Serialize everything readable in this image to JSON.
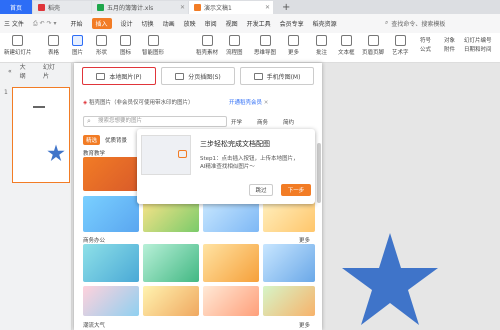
{
  "tabs": {
    "home": "首页",
    "t1": "稻壳",
    "t2": "五月的簿簿计.xls",
    "t3": "演示文稿1",
    "plus": "+"
  },
  "menu": {
    "file": "三 文件",
    "items": [
      "开始",
      "插入",
      "设计",
      "切换",
      "动画",
      "放映",
      "审阅",
      "视图",
      "开发工具",
      "会员专享",
      "稻壳资源"
    ],
    "active_index": 1,
    "search": "查找命令、搜索模板"
  },
  "ribbon": {
    "new_slide": "新建幻灯片",
    "table": "表格",
    "picture": "图片",
    "shape": "形状",
    "icon": "图标",
    "smart_graphic": "智能图形",
    "docer_material": "稻壳素材",
    "flowchart": "流程图",
    "mind_map": "思维导图",
    "more": "更多",
    "comment": "批注",
    "textbox": "文本框",
    "header_footer": "页眉页脚",
    "art_text": "艺术字",
    "symbol": "符号",
    "formula": "公式",
    "object": "对象",
    "slide_number": "幻灯片编号",
    "attachment": "附件",
    "date_time": "日期和时间"
  },
  "leftpanel": {
    "tab_outline": "大纲",
    "tab_slides": "幻灯片",
    "slide_num": "1"
  },
  "popup": {
    "tabs": [
      "本地图片(P)",
      "分页插图(S)",
      "手机传图(M)"
    ],
    "notice": "稻壳图片（非会员仅可使用带水印的图片）",
    "notice_link": "开通稻壳会员",
    "search_placeholder": "搜索您想要的图片",
    "buttons": [
      "开学",
      "商务",
      "简约"
    ],
    "categories": [
      "精选",
      "优质背景"
    ],
    "sections": [
      "教育教学",
      "商务办公",
      "潮流大气"
    ],
    "more": "更多"
  },
  "tip": {
    "title": "三步轻松完成文档配图",
    "line1": "Step1：点击插入按钮，上传本地图片，",
    "line2": "AI精准查找相似图片～",
    "skip": "跳过",
    "next": "下一步"
  },
  "colors": {
    "accent": "#f27c25",
    "brand": "#2d6df6",
    "star": "#3f74c9",
    "selected": "#e0353a"
  }
}
